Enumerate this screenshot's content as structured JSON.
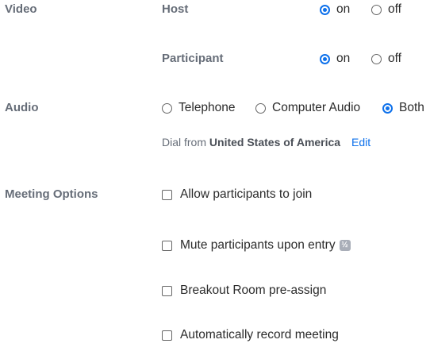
{
  "video": {
    "section_label": "Video",
    "host": {
      "label": "Host",
      "on_label": "on",
      "off_label": "off",
      "selected": "on"
    },
    "participant": {
      "label": "Participant",
      "on_label": "on",
      "off_label": "off",
      "selected": "on"
    }
  },
  "audio": {
    "section_label": "Audio",
    "options": [
      "Telephone",
      "Computer Audio",
      "Both"
    ],
    "selected": "Both",
    "dial_prefix": "Dial from",
    "dial_country": "United States of America",
    "edit_label": "Edit"
  },
  "meeting_options": {
    "section_label": "Meeting Options",
    "items": [
      {
        "label": "Allow participants to join",
        "checked": false
      },
      {
        "label": "Mute participants upon entry",
        "checked": false,
        "badge": "½"
      },
      {
        "label": "Breakout Room pre-assign",
        "checked": false
      },
      {
        "label": "Automatically record meeting",
        "checked": false
      }
    ]
  },
  "colors": {
    "accent": "#0e71eb",
    "label_gray": "#666d78",
    "text": "#2b2b2b"
  }
}
